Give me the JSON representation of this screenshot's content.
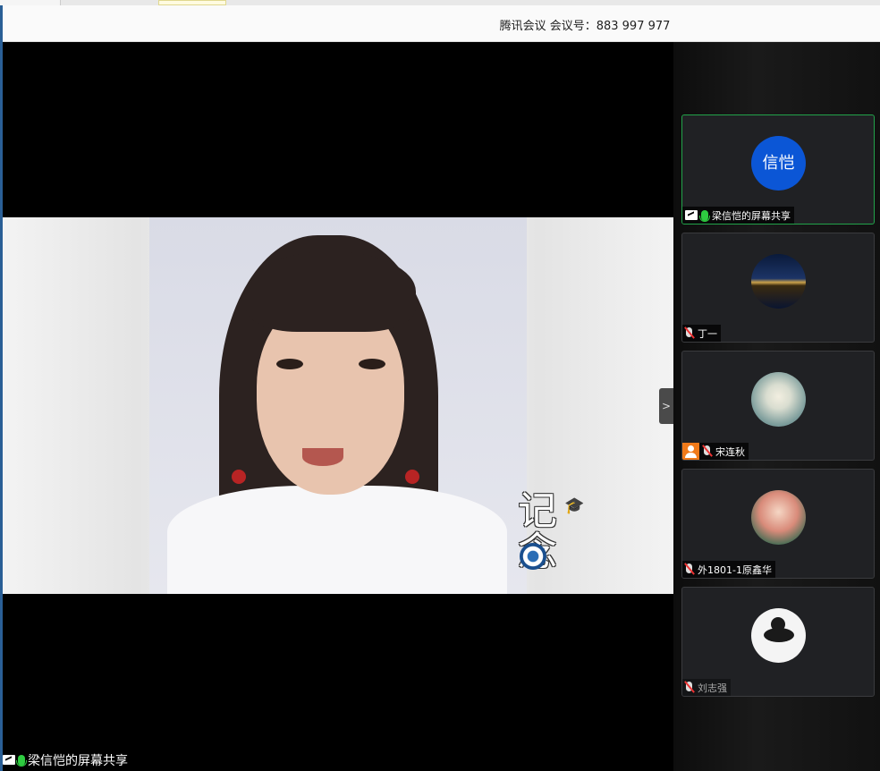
{
  "titlebar": {
    "title": "腾讯会议 会议号：883 997 977"
  },
  "main": {
    "share_label": "梁信恺的屏幕共享",
    "watermark_text": "记念",
    "collapse_icon": "chevron-right-icon"
  },
  "participants": [
    {
      "avatar_text": "信恺",
      "name": "梁信恺的屏幕共享",
      "mic": "on",
      "sharing": true,
      "active": true
    },
    {
      "avatar_text": "",
      "name": "丁一",
      "mic": "muted",
      "avatar": "city-night-photo"
    },
    {
      "avatar_text": "",
      "name": "宋连秋",
      "mic": "muted",
      "host": true,
      "avatar": "flower-illustration"
    },
    {
      "avatar_text": "",
      "name": "外1801-1原鑫华",
      "mic": "muted",
      "avatar": "anime-girl"
    },
    {
      "avatar_text": "",
      "name": "刘志强",
      "mic": "muted",
      "avatar": "panda"
    }
  ],
  "colors": {
    "active_border": "#22a34a",
    "avatar_blue": "#0b56d6",
    "host_badge": "#f07a1a"
  }
}
